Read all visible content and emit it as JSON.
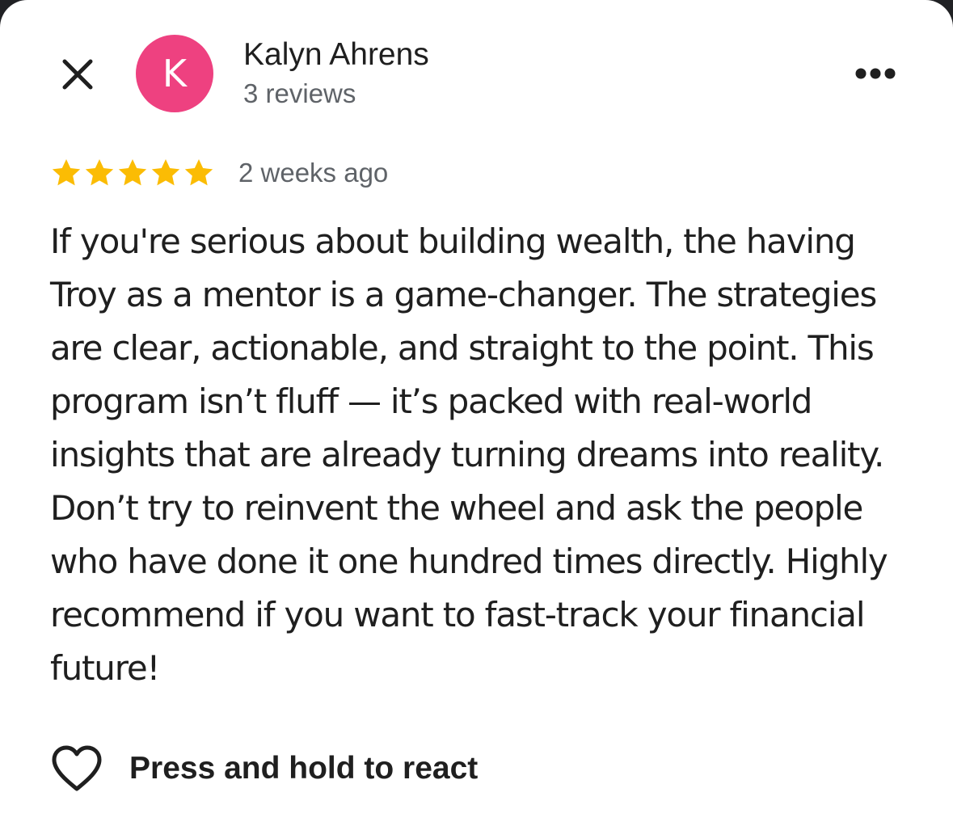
{
  "colors": {
    "avatar_bg": "#ee4180",
    "star": "#fbbc04",
    "text_primary": "#1f1f1f",
    "text_secondary": "#5f6368"
  },
  "header": {
    "close_icon": "close-icon",
    "more_icon": "more-horizontal-icon"
  },
  "author": {
    "initial": "K",
    "name": "Kalyn Ahrens",
    "review_count": "3 reviews"
  },
  "review": {
    "rating": 5,
    "max_rating": 5,
    "time": "2 weeks ago",
    "text": "If you're serious about building wealth, the having Troy as a mentor is a game-changer. The strategies are clear, actionable, and straight to the point. This program isn’t fluff — it’s packed with real-world insights that are already turning dreams into reality. Don’t try to reinvent the wheel and ask the people who have done it one hundred times directly. Highly recommend if you want to fast-track your financial future!"
  },
  "reaction": {
    "icon": "heart-outline-icon",
    "label": "Press and hold to react"
  }
}
